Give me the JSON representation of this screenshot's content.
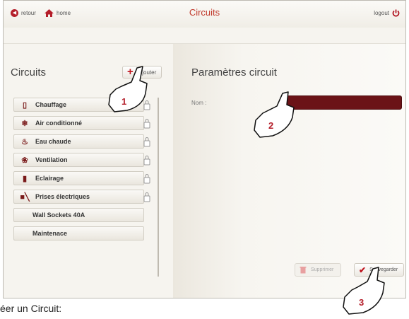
{
  "topbar": {
    "back_label": "retour",
    "home_label": "home",
    "title": "Circuits",
    "logout_label": "logout"
  },
  "left": {
    "heading": "Circuits",
    "add_label": "ajouter",
    "items": [
      {
        "label": "Chauffage",
        "icon": "thermometer-icon",
        "locked": true
      },
      {
        "label": "Air conditionné",
        "icon": "snowflake-icon",
        "locked": true
      },
      {
        "label": "Eau chaude",
        "icon": "water-heater-icon",
        "locked": true
      },
      {
        "label": "Ventilation",
        "icon": "fan-icon",
        "locked": true
      },
      {
        "label": "Eclairage",
        "icon": "lamp-icon",
        "locked": true
      },
      {
        "label": "Prises électriques",
        "icon": "plug-icon",
        "locked": true
      },
      {
        "label": "Wall Sockets 40A",
        "icon": "",
        "locked": false
      },
      {
        "label": "Maintenace",
        "icon": "",
        "locked": false
      }
    ]
  },
  "right": {
    "heading": "Paramètres circuit",
    "name_label": "Nom :",
    "name_value": "",
    "delete_label": "Supprimer",
    "save_label": "Sauvegarder"
  },
  "callouts": [
    "1",
    "2",
    "3"
  ],
  "caption": "éer un Circuit:",
  "colors": {
    "accent": "#c0161f",
    "title_red": "#c0392b",
    "input_bg": "#6b1317",
    "background": "#f6f4ef"
  }
}
